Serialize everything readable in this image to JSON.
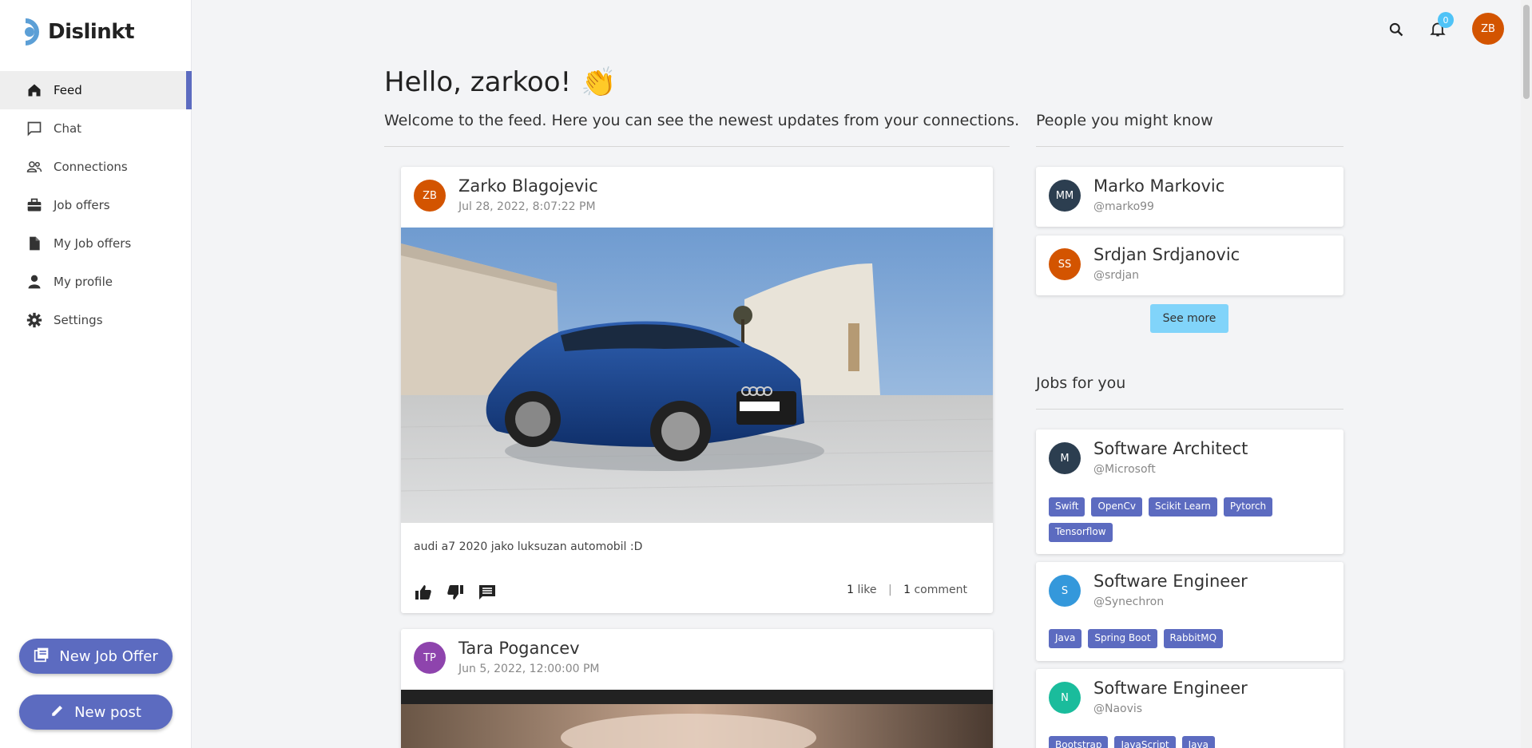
{
  "app": {
    "name": "Dislinkt"
  },
  "sidebar": {
    "items": [
      {
        "label": "Feed",
        "icon": "home-icon",
        "active": true
      },
      {
        "label": "Chat",
        "icon": "chat-icon"
      },
      {
        "label": "Connections",
        "icon": "people-icon"
      },
      {
        "label": "Job offers",
        "icon": "briefcase-icon"
      },
      {
        "label": "My Job offers",
        "icon": "document-icon"
      },
      {
        "label": "My profile",
        "icon": "person-icon"
      },
      {
        "label": "Settings",
        "icon": "gear-icon"
      }
    ],
    "new_job_offer_label": "New Job Offer",
    "new_post_label": "New post"
  },
  "topbar": {
    "notification_count": "0",
    "user_initials": "ZB",
    "user_avatar_color": "#d35400"
  },
  "main": {
    "greeting": "Hello, zarkoo!",
    "greeting_emoji": "👏",
    "welcome": "Welcome to the feed. Here you can see the newest updates from your connections."
  },
  "posts": [
    {
      "initials": "ZB",
      "avatar_color": "#d35400",
      "author": "Zarko Blagojevic",
      "date": "Jul 28, 2022, 8:07:22 PM",
      "image": "blue-car-photo",
      "text": "audi a7 2020 jako luksuzan automobil :D",
      "likes": "1",
      "likes_label": "like",
      "comments": "1",
      "comments_label": "comment",
      "separator": "|"
    },
    {
      "initials": "TP",
      "avatar_color": "#8e44ad",
      "author": "Tara Pogancev",
      "date": "Jun 5, 2022, 12:00:00 PM",
      "image": "photo"
    }
  ],
  "people": {
    "title": "People you might know",
    "items": [
      {
        "initials": "MM",
        "avatar_color": "#2c3e50",
        "name": "Marko Markovic",
        "handle": "@marko99"
      },
      {
        "initials": "SS",
        "avatar_color": "#d35400",
        "name": "Srdjan Srdjanovic",
        "handle": "@srdjan"
      }
    ],
    "see_more": "See more"
  },
  "jobs": {
    "title": "Jobs for you",
    "items": [
      {
        "initials": "M",
        "avatar_color": "#2c3e50",
        "title": "Software Architect",
        "company": "@Microsoft",
        "tags": [
          "Swift",
          "OpenCv",
          "Scikit Learn",
          "Pytorch",
          "Tensorflow"
        ]
      },
      {
        "initials": "S",
        "avatar_color": "#3498db",
        "title": "Software Engineer",
        "company": "@Synechron",
        "tags": [
          "Java",
          "Spring Boot",
          "RabbitMQ"
        ]
      },
      {
        "initials": "N",
        "avatar_color": "#1abc9c",
        "title": "Software Engineer",
        "company": "@Naovis",
        "tags": [
          "Bootstrap",
          "JavaScript",
          "Java"
        ]
      }
    ]
  }
}
